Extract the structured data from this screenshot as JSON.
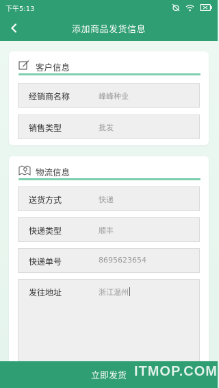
{
  "status_bar": {
    "time": "下午5:13",
    "icons": [
      "alarm-off-icon",
      "wifi-icon",
      "battery-icon"
    ]
  },
  "nav": {
    "title": "添加商品发货信息",
    "back_icon": "chevron-left-icon"
  },
  "customer_section": {
    "title": "客户信息",
    "icon": "edit-note-icon",
    "fields": [
      {
        "label": "经销商名称",
        "value": "峰峰种业"
      },
      {
        "label": "销售类型",
        "value": "批发"
      }
    ]
  },
  "logistics_section": {
    "title": "物流信息",
    "icon": "map-pin-icon",
    "fields": [
      {
        "label": "送货方式",
        "value": "快递"
      },
      {
        "label": "快递类型",
        "value": "顺丰"
      },
      {
        "label": "快递单号",
        "value": "8695623654"
      },
      {
        "label": "发往地址",
        "value": "浙江温州"
      }
    ]
  },
  "submit_label": "立即发货",
  "watermark": "ITMOP.COM",
  "colors": {
    "primary": "#2f9e73",
    "accent_rule": "#7dcfae",
    "field_bg": "#efefef",
    "page_bg": "#eaf6f0"
  }
}
